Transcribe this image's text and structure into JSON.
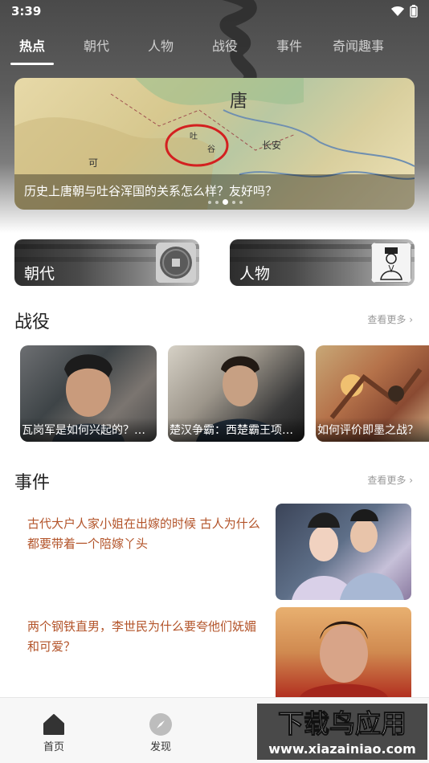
{
  "status": {
    "time": "3:39",
    "icons": [
      "wifi-icon",
      "battery-icon"
    ]
  },
  "tabs": [
    {
      "label": "热点",
      "active": true
    },
    {
      "label": "朝代",
      "active": false
    },
    {
      "label": "人物",
      "active": false
    },
    {
      "label": "战役",
      "active": false
    },
    {
      "label": "事件",
      "active": false
    },
    {
      "label": "奇闻趣事",
      "active": false
    }
  ],
  "banner": {
    "caption": "历史上唐朝与吐谷浑国的关系怎么样？友好吗？",
    "map_labels": [
      "唐",
      "长安",
      "可",
      "吐",
      "谷"
    ],
    "page_count": 5,
    "active_page": 3
  },
  "categories": [
    {
      "label": "朝代",
      "thumb": "coin-icon"
    },
    {
      "label": "人物",
      "thumb": "portrait-icon"
    }
  ],
  "battles": {
    "title": "战役",
    "more": "查看更多",
    "items": [
      {
        "caption": "瓦岗军是如何兴起的？史上..."
      },
      {
        "caption": "楚汉争霸：西楚霸王项羽..."
      },
      {
        "caption": "如何评价即墨之战？"
      }
    ]
  },
  "events": {
    "title": "事件",
    "more": "查看更多",
    "items": [
      {
        "text": "古代大户人家小姐在出嫁的时候 古人为什么都要带着一个陪嫁丫头"
      },
      {
        "text": "两个钢铁直男，李世民为什么要夸他们妩媚和可爱？"
      }
    ]
  },
  "bottom_nav": [
    {
      "label": "首页",
      "icon": "home-icon"
    },
    {
      "label": "发现",
      "icon": "compass-icon"
    }
  ],
  "watermark": {
    "line1": "下载鸟应用",
    "line2": "www.xiazainiao.com"
  },
  "colors": {
    "event_text": "#b3542a",
    "accent": "#ffffff",
    "header_dark": "#4a4a4a"
  }
}
